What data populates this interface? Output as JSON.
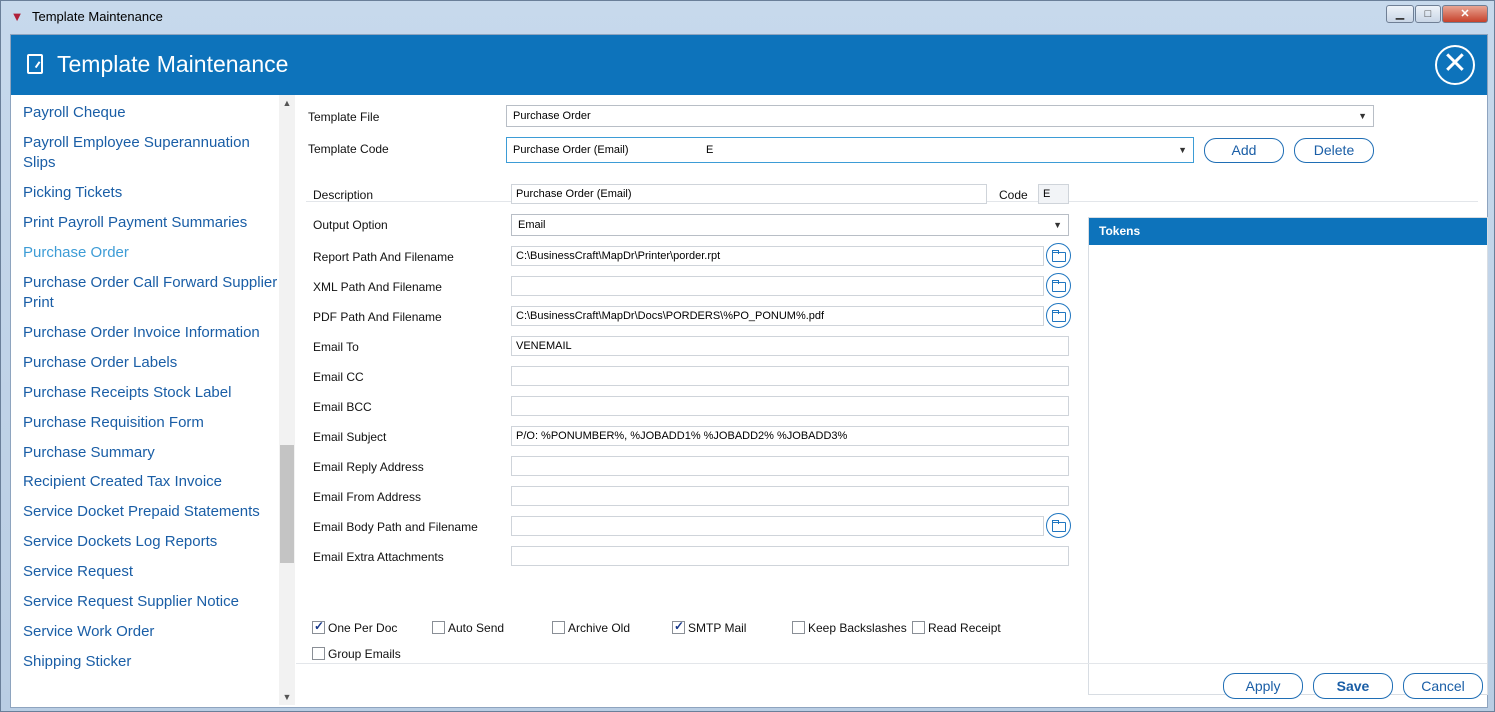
{
  "window": {
    "title": "Template Maintenance",
    "controls": {
      "minimize": "▁",
      "maximize": "□",
      "close": "✕"
    }
  },
  "header": {
    "title": "Template Maintenance",
    "close_glyph": "✕"
  },
  "sidebar": {
    "items": [
      "Payroll Cheque",
      "Payroll Employee Superannuation Slips",
      "Picking Tickets",
      "Print Payroll Payment Summaries",
      "Purchase Order",
      "Purchase Order Call Forward Supplier Print",
      "Purchase Order Invoice Information",
      "Purchase Order Labels",
      "Purchase Receipts Stock Label",
      "Purchase Requisition Form",
      "Purchase Summary",
      "Recipient Created Tax Invoice",
      "Service Docket Prepaid Statements",
      "Service Dockets Log Reports",
      "Service Request",
      "Service Request Supplier Notice",
      "Service Work Order",
      "Shipping Sticker"
    ],
    "active_item": "Purchase Order"
  },
  "template": {
    "file_label": "Template File",
    "file_value": "Purchase Order",
    "code_label": "Template Code",
    "code_value": "Purchase Order (Email)",
    "code_short": "E",
    "add_label": "Add",
    "delete_label": "Delete"
  },
  "form": {
    "description": {
      "label": "Description",
      "value": "Purchase Order (Email)"
    },
    "code": {
      "label": "Code",
      "value": "E"
    },
    "output_option": {
      "label": "Output Option",
      "value": "Email"
    },
    "report_path": {
      "label": "Report Path And Filename",
      "value": "C:\\BusinessCraft\\MapDr\\Printer\\porder.rpt"
    },
    "xml_path": {
      "label": "XML Path And Filename",
      "value": ""
    },
    "pdf_path": {
      "label": "PDF Path And Filename",
      "value": "C:\\BusinessCraft\\MapDr\\Docs\\PORDERS\\%PO_PONUM%.pdf"
    },
    "email_to": {
      "label": "Email To",
      "value": "VENEMAIL"
    },
    "email_cc": {
      "label": "Email CC",
      "value": ""
    },
    "email_bcc": {
      "label": "Email BCC",
      "value": ""
    },
    "email_subject": {
      "label": "Email Subject",
      "value": "P/O: %PONUMBER%, %JOBADD1% %JOBADD2% %JOBADD3%"
    },
    "email_reply": {
      "label": "Email Reply Address",
      "value": ""
    },
    "email_from": {
      "label": "Email From Address",
      "value": ""
    },
    "email_body_path": {
      "label": "Email Body Path and Filename",
      "value": ""
    },
    "email_attachments": {
      "label": "Email Extra Attachments",
      "value": ""
    }
  },
  "tokens": {
    "title": "Tokens"
  },
  "options": [
    {
      "label": "One Per Doc",
      "checked": true
    },
    {
      "label": "Auto Send",
      "checked": false
    },
    {
      "label": "Archive Old",
      "checked": false
    },
    {
      "label": "SMTP Mail",
      "checked": true
    },
    {
      "label": "Keep Backslashes",
      "checked": false
    },
    {
      "label": "Read Receipt",
      "checked": false
    },
    {
      "label": "Group Emails",
      "checked": false
    }
  ],
  "footer": {
    "apply_label": "Apply",
    "save_label": "Save",
    "cancel_label": "Cancel"
  },
  "icons": {
    "dropdown": "chevron-down-icon",
    "folder": "folder-open-icon",
    "close": "close-icon",
    "document": "document-edit-icon"
  },
  "colors": {
    "header_blue": "#0d73bb",
    "link_blue": "#1a5ea6",
    "active_link": "#3d9cd6"
  }
}
